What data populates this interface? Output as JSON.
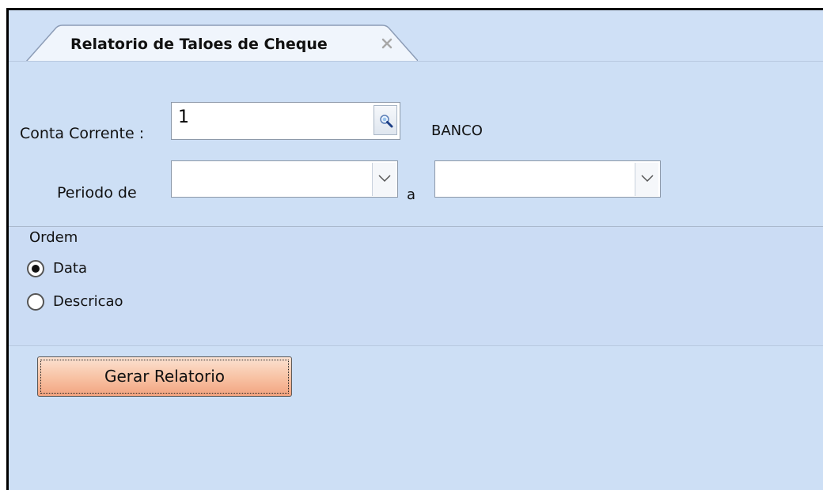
{
  "tab": {
    "title": "Relatorio de Taloes de Cheque",
    "close_icon": "close-icon"
  },
  "conta": {
    "label": "Conta Corrente :",
    "value": "1",
    "lookup_icon": "search-icon",
    "bank_name": "BANCO"
  },
  "periodo": {
    "label": "Periodo de",
    "from_value": "",
    "separator": "a",
    "to_value": "",
    "dropdown_icon": "chevron-down-icon"
  },
  "ordem": {
    "label": "Ordem",
    "options": [
      {
        "label": "Data",
        "checked": true
      },
      {
        "label": "Descricao",
        "checked": false
      }
    ]
  },
  "actions": {
    "generate_label": "Gerar Relatorio"
  },
  "colors": {
    "panel_bg": "#cddff5",
    "button_accent": "#f8c4a6"
  }
}
